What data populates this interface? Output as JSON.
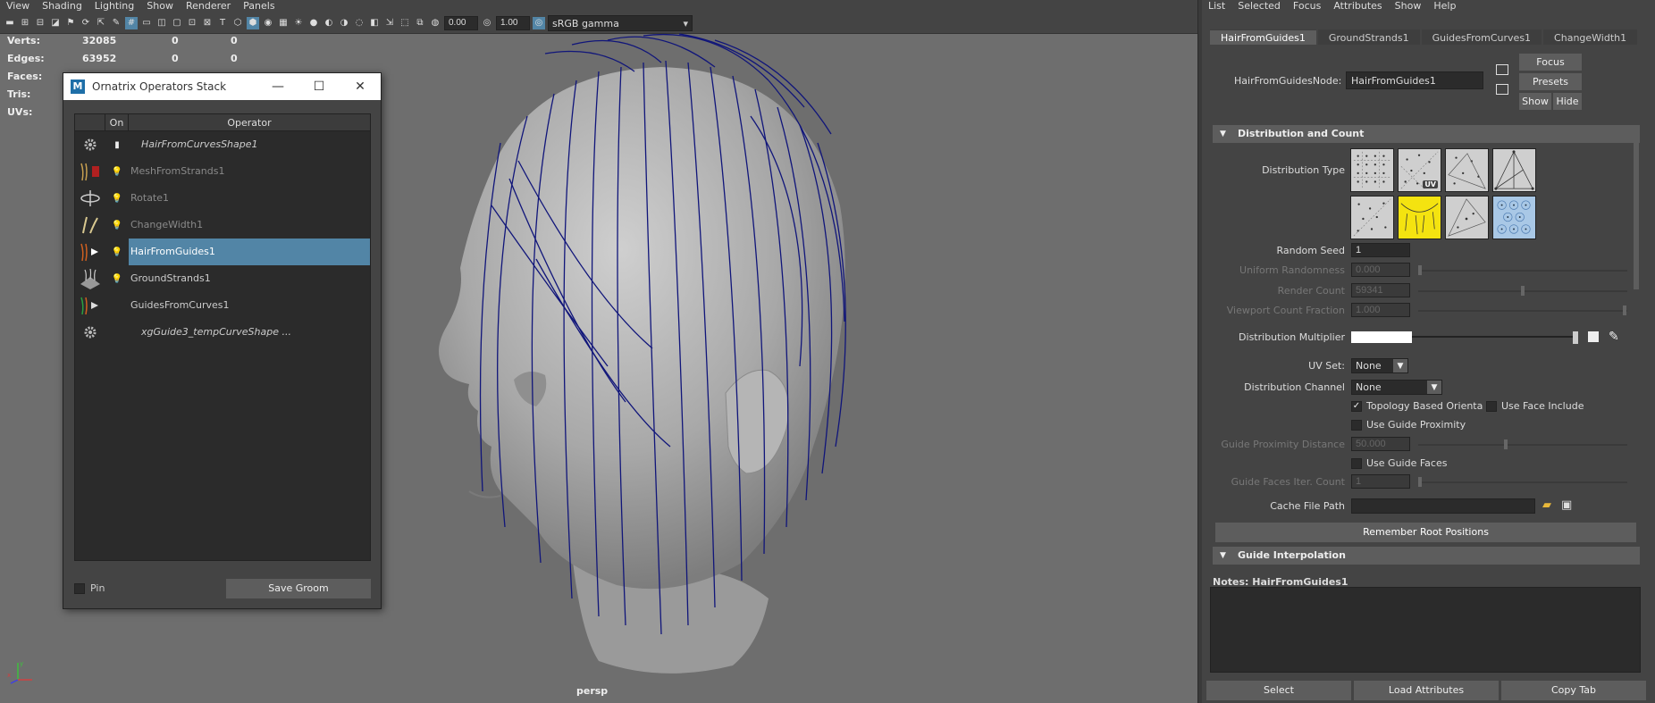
{
  "viewport": {
    "menu": [
      "View",
      "Shading",
      "Lighting",
      "Show",
      "Renderer",
      "Panels"
    ],
    "toolbar": {
      "field1": "0.00",
      "field2": "1.00",
      "color_space": "sRGB gamma"
    },
    "hud": [
      {
        "label": "Verts:",
        "v1": "32085",
        "v2": "0",
        "v3": "0"
      },
      {
        "label": "Edges:",
        "v1": "63952",
        "v2": "0",
        "v3": "0"
      },
      {
        "label": "Faces:",
        "v1": "",
        "v2": "",
        "v3": ""
      },
      {
        "label": "Tris:",
        "v1": "",
        "v2": "",
        "v3": ""
      },
      {
        "label": "UVs:",
        "v1": "",
        "v2": "",
        "v3": ""
      }
    ],
    "camera": "persp",
    "axis_x": "x",
    "axis_y": "y"
  },
  "ops_window": {
    "title": "Ornatrix Operators Stack",
    "logo": "M",
    "col_on": "On",
    "col_operator": "Operator",
    "operators": [
      {
        "name": "HairFromCurvesShape1",
        "icon": "gear-icon"
      },
      {
        "name": "MeshFromStrands1",
        "icon": "mesh-from-strands-icon"
      },
      {
        "name": "Rotate1",
        "icon": "rotate-icon"
      },
      {
        "name": "ChangeWidth1",
        "icon": "change-width-icon"
      },
      {
        "name": "HairFromGuides1",
        "icon": "hair-from-guides-icon"
      },
      {
        "name": "GroundStrands1",
        "icon": "ground-strands-icon"
      },
      {
        "name": "GuidesFromCurves1",
        "icon": "guides-from-curves-icon"
      },
      {
        "name": "xgGuide3_tempCurveShape ...",
        "icon": "gear-icon"
      }
    ],
    "pin_label": "Pin",
    "save_groom": "Save Groom",
    "window_buttons": [
      "—",
      "☐",
      "✕"
    ]
  },
  "attr_editor": {
    "menu": [
      "List",
      "Selected",
      "Focus",
      "Attributes",
      "Show",
      "Help"
    ],
    "tabs": [
      "HairFromGuides1",
      "GroundStrands1",
      "GuidesFromCurves1",
      "ChangeWidth1"
    ],
    "node_label": "HairFromGuidesNode:",
    "node_value": "HairFromGuides1",
    "focus_btn": "Focus",
    "presets_btn": "Presets",
    "show_btn": "Show",
    "hide_btn": "Hide",
    "section1": "Distribution and Count",
    "distribution_type_label": "Distribution Type",
    "uv_badge": "UV",
    "random_seed_label": "Random Seed",
    "random_seed_value": "1",
    "uniform_randomness_label": "Uniform Randomness",
    "uniform_randomness_value": "0.000",
    "render_count_label": "Render Count",
    "render_count_value": "59341",
    "viewport_count_label": "Viewport Count Fraction",
    "viewport_count_value": "1.000",
    "dist_multiplier_label": "Distribution Multiplier",
    "uv_set_label": "UV Set:",
    "uv_set_value": "None",
    "dist_channel_label": "Distribution Channel",
    "dist_channel_value": "None",
    "topology_label": "Topology Based Orienta",
    "use_face_include_label": "Use Face Include",
    "use_guide_proximity_label": "Use Guide Proximity",
    "guide_prox_dist_label": "Guide Proximity Distance",
    "guide_prox_dist_value": "50.000",
    "use_guide_faces_label": "Use Guide Faces",
    "guide_faces_iter_label": "Guide Faces Iter. Count",
    "guide_faces_iter_value": "1",
    "cache_file_label": "Cache File Path",
    "remember_btn": "Remember Root Positions",
    "section2": "Guide Interpolation",
    "notes_label": "Notes:  HairFromGuides1",
    "bottom": {
      "select": "Select",
      "load": "Load Attributes",
      "copy": "Copy Tab"
    }
  }
}
